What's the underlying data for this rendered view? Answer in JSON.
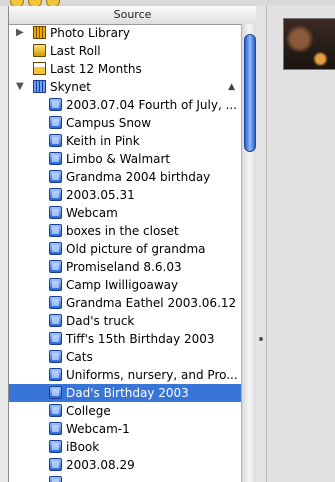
{
  "source": {
    "header": "Source",
    "items": [
      {
        "label": "Photo Library",
        "level": 0,
        "icon": "photo-library-icon",
        "disclosure": "collapsed"
      },
      {
        "label": "Last Roll",
        "level": 0,
        "icon": "film-roll-icon"
      },
      {
        "label": "Last 12 Months",
        "level": 0,
        "icon": "calendar-icon"
      },
      {
        "label": "Skynet",
        "level": 0,
        "icon": "shared-library-icon",
        "disclosure": "expanded"
      },
      {
        "label": "2003.07.04 Fourth of July, ...",
        "level": 1,
        "icon": "album-icon"
      },
      {
        "label": "Campus Snow",
        "level": 1,
        "icon": "album-icon"
      },
      {
        "label": "Keith in Pink",
        "level": 1,
        "icon": "album-icon"
      },
      {
        "label": "Limbo & Walmart",
        "level": 1,
        "icon": "album-icon"
      },
      {
        "label": "Grandma 2004 birthday",
        "level": 1,
        "icon": "album-icon"
      },
      {
        "label": "2003.05.31",
        "level": 1,
        "icon": "album-icon"
      },
      {
        "label": "Webcam",
        "level": 1,
        "icon": "album-icon"
      },
      {
        "label": "boxes in the closet",
        "level": 1,
        "icon": "album-icon"
      },
      {
        "label": "Old picture of grandma",
        "level": 1,
        "icon": "album-icon"
      },
      {
        "label": "Promiseland 8.6.03",
        "level": 1,
        "icon": "album-icon"
      },
      {
        "label": "Camp Iwilligoaway",
        "level": 1,
        "icon": "album-icon"
      },
      {
        "label": "Grandma Eathel 2003.06.12",
        "level": 1,
        "icon": "album-icon"
      },
      {
        "label": "Dad's truck",
        "level": 1,
        "icon": "album-icon"
      },
      {
        "label": "Tiff's 15th Birthday 2003",
        "level": 1,
        "icon": "album-icon"
      },
      {
        "label": "Cats",
        "level": 1,
        "icon": "album-icon"
      },
      {
        "label": "Uniforms, nursery, and Pro...",
        "level": 1,
        "icon": "album-icon"
      },
      {
        "label": "Dad's Birthday 2003",
        "level": 1,
        "icon": "album-icon",
        "selected": true
      },
      {
        "label": "College",
        "level": 1,
        "icon": "album-icon"
      },
      {
        "label": "Webcam-1",
        "level": 1,
        "icon": "album-icon"
      },
      {
        "label": "iBook",
        "level": 1,
        "icon": "album-icon"
      },
      {
        "label": "2003.08.29",
        "level": 1,
        "icon": "album-icon"
      },
      {
        "label": "",
        "level": 1,
        "icon": "album-icon"
      }
    ],
    "selected_color": "#3875d7"
  },
  "viewer": {
    "thumbnail": "birthday-photo-thumbnail"
  }
}
